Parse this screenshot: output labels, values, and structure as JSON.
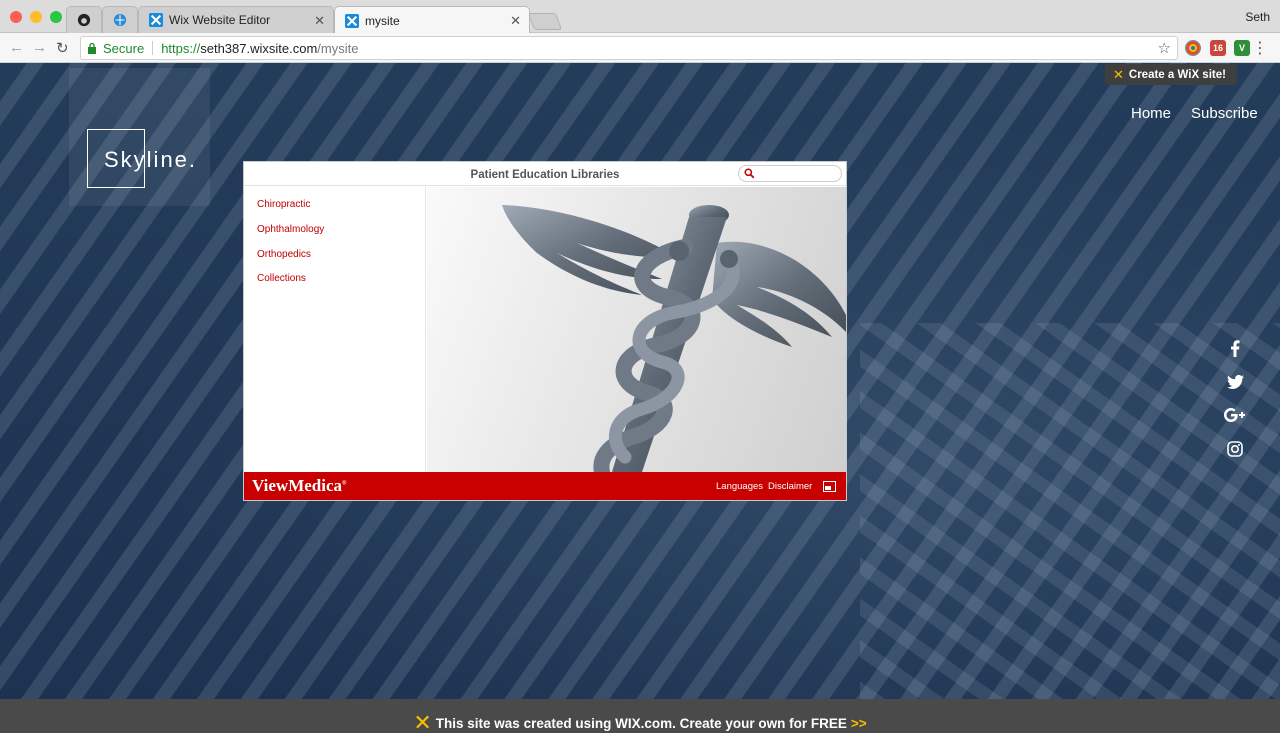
{
  "browser": {
    "tabs": [
      {
        "label": ""
      },
      {
        "label": ""
      },
      {
        "label": "Wix Website Editor"
      },
      {
        "label": "mysite"
      }
    ],
    "profile": "Seth",
    "address": {
      "secure_label": "Secure",
      "scheme": "https://",
      "host": "seth387.wixsite.com",
      "path": "/mysite"
    },
    "extension_calendar_day": "16",
    "extension_v": "V"
  },
  "site": {
    "logo": "Skyline.",
    "wix_badge": "Create a WiX site!",
    "nav": [
      {
        "label": "Home"
      },
      {
        "label": "Subscribe"
      }
    ],
    "social_icons": [
      "facebook-icon",
      "twitter-icon",
      "google-plus-icon",
      "instagram-icon"
    ]
  },
  "widget": {
    "title": "Patient Education Libraries",
    "search_placeholder": "",
    "libraries": [
      {
        "label": "Chiropractic"
      },
      {
        "label": "Ophthalmology"
      },
      {
        "label": "Orthopedics"
      },
      {
        "label": "Collections"
      }
    ],
    "brand": "ViewMedica",
    "footer_links": [
      {
        "label": "Languages"
      },
      {
        "label": "Disclaimer"
      }
    ],
    "accent_color": "#c80000"
  },
  "wix_banner": {
    "text": "This site was created using WIX.com. Create your own for FREE",
    "arrow": ">>"
  }
}
